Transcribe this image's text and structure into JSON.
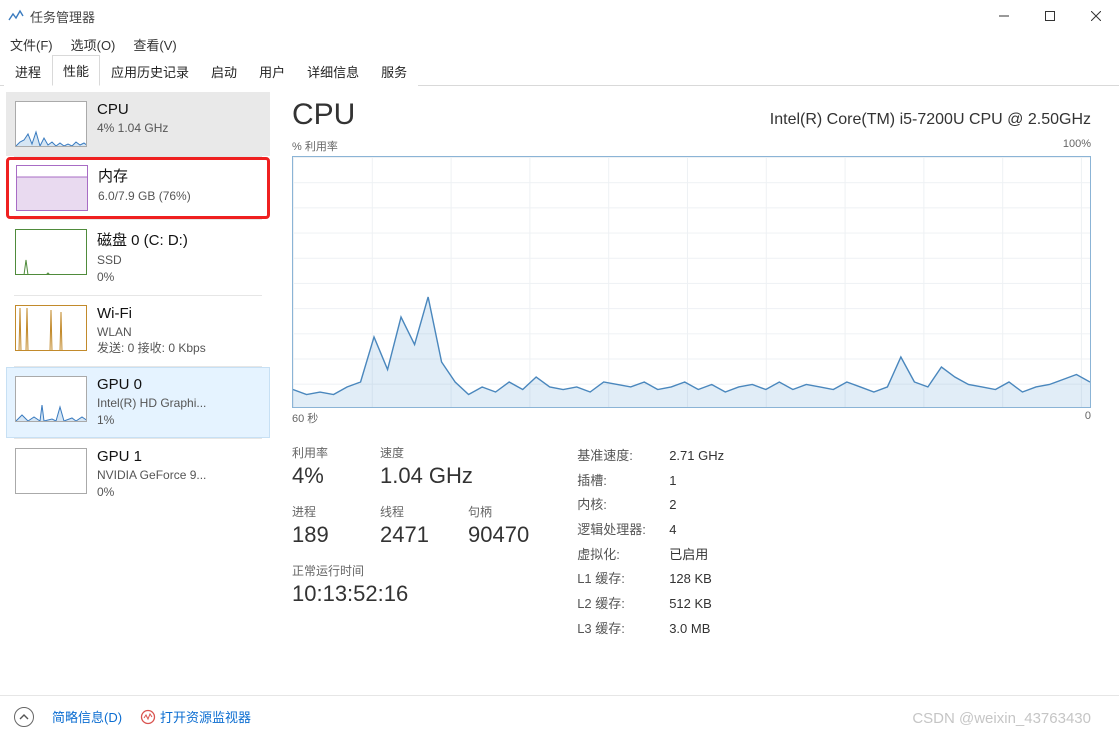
{
  "window": {
    "title": "任务管理器"
  },
  "menu": {
    "file": "文件(F)",
    "options": "选项(O)",
    "view": "查看(V)"
  },
  "tabs": [
    {
      "label": "进程"
    },
    {
      "label": "性能",
      "active": true
    },
    {
      "label": "应用历史记录"
    },
    {
      "label": "启动"
    },
    {
      "label": "用户"
    },
    {
      "label": "详细信息"
    },
    {
      "label": "服务"
    }
  ],
  "sidebar": [
    {
      "id": "cpu",
      "title": "CPU",
      "sub": "4%  1.04 GHz",
      "selected": true,
      "color": "#5b9bd5"
    },
    {
      "id": "memory",
      "title": "内存",
      "sub": "6.0/7.9 GB (76%)",
      "highlighted_red": true,
      "color": "#9b59b6"
    },
    {
      "id": "disk",
      "title": "磁盘 0 (C: D:)",
      "sub": "SSD",
      "sub2": "0%",
      "color": "#4f8b3b"
    },
    {
      "id": "wifi",
      "title": "Wi-Fi",
      "sub": "WLAN",
      "sub2": "发送: 0  接收: 0 Kbps",
      "color": "#c28a2b"
    },
    {
      "id": "gpu0",
      "title": "GPU 0",
      "sub": "Intel(R) HD Graphi...",
      "sub2": "1%",
      "selected_light": true,
      "color": "#5b9bd5"
    },
    {
      "id": "gpu1",
      "title": "GPU 1",
      "sub": "NVIDIA GeForce 9...",
      "sub2": "0%",
      "color": "#5b9bd5"
    }
  ],
  "content": {
    "heading": "CPU",
    "model": "Intel(R) Core(TM) i5-7200U CPU @ 2.50GHz",
    "chart_top_left": "% 利用率",
    "chart_top_right": "100%",
    "chart_bottom_left": "60 秒",
    "chart_bottom_right": "0",
    "stats": {
      "util_label": "利用率",
      "util_value": "4%",
      "speed_label": "速度",
      "speed_value": "1.04 GHz",
      "processes_label": "进程",
      "processes_value": "189",
      "threads_label": "线程",
      "threads_value": "2471",
      "handles_label": "句柄",
      "handles_value": "90470",
      "uptime_label": "正常运行时间",
      "uptime_value": "10:13:52:16"
    },
    "specs": [
      {
        "key": "基准速度:",
        "val": "2.71 GHz"
      },
      {
        "key": "插槽:",
        "val": "1"
      },
      {
        "key": "内核:",
        "val": "2"
      },
      {
        "key": "逻辑处理器:",
        "val": "4"
      },
      {
        "key": "虚拟化:",
        "val": "已启用"
      },
      {
        "key": "L1 缓存:",
        "val": "128 KB"
      },
      {
        "key": "L2 缓存:",
        "val": "512 KB"
      },
      {
        "key": "L3 缓存:",
        "val": "3.0 MB"
      }
    ]
  },
  "footer": {
    "brief": "简略信息(D)",
    "resmon": "打开资源监视器"
  },
  "watermark": "CSDN @weixin_43763430",
  "chart_data": {
    "type": "line",
    "title": "% 利用率",
    "xlabel": "60 秒",
    "ylabel": "% 利用率",
    "ylim": [
      0,
      100
    ],
    "xrange_seconds": [
      60,
      0
    ],
    "series": [
      {
        "name": "CPU",
        "values": [
          7,
          5,
          6,
          5,
          8,
          10,
          28,
          15,
          36,
          25,
          44,
          18,
          10,
          5,
          8,
          6,
          10,
          7,
          12,
          8,
          7,
          8,
          6,
          10,
          9,
          8,
          10,
          7,
          8,
          10,
          7,
          9,
          6,
          8,
          9,
          7,
          10,
          7,
          9,
          8,
          7,
          10,
          8,
          6,
          8,
          20,
          10,
          8,
          16,
          12,
          9,
          8,
          7,
          10,
          6,
          8,
          9,
          11,
          13,
          10
        ]
      }
    ]
  }
}
